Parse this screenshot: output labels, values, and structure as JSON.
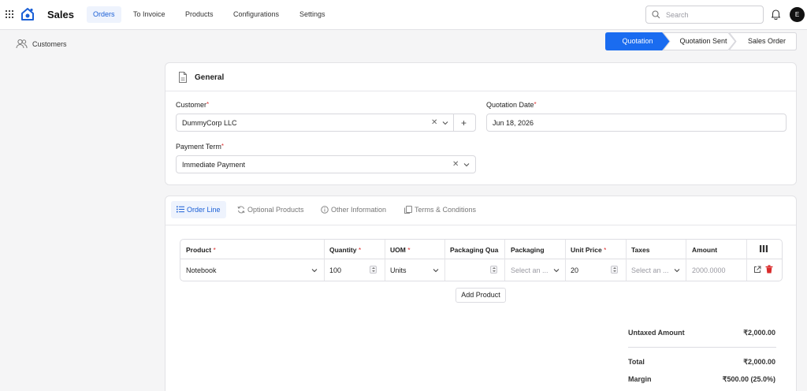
{
  "header": {
    "app_title": "Sales",
    "nav": [
      "Orders",
      "To Invoice",
      "Products",
      "Configurations",
      "Settings"
    ],
    "active_nav": "Orders",
    "search_placeholder": "Search",
    "avatar_initial": "E",
    "icons": [
      "apps-grid-icon",
      "app-logo-icon",
      "search-icon",
      "bell-icon"
    ]
  },
  "sidebar": {
    "items": [
      {
        "label": "Customers",
        "icon": "users-icon"
      }
    ]
  },
  "statusbar": {
    "steps": [
      "Quotation",
      "Quotation Sent",
      "Sales Order"
    ],
    "active": "Quotation",
    "active_color": "#1a6cf0"
  },
  "general": {
    "title": "General",
    "customer_label": "Customer",
    "customer_value": "DummyCorp LLC",
    "date_label": "Quotation Date",
    "date_value": "Jun 18, 2026",
    "term_label": "Payment Term",
    "term_value": "Immediate Payment"
  },
  "tabs": [
    "Order Line",
    "Optional Products",
    "Other Information",
    "Terms & Conditions"
  ],
  "order_lines": {
    "columns": [
      "Product",
      "Quantity",
      "UOM",
      "Packaging Qua",
      "Packaging",
      "Unit Price",
      "Taxes",
      "Amount"
    ],
    "rows": [
      {
        "product": "Notebook",
        "quantity": "100",
        "uom": "Units",
        "packaging_qty": "",
        "packaging": "Select an ...",
        "unit_price": "20",
        "taxes": "Select an ...",
        "amount": "2000.0000"
      }
    ],
    "add_product_label": "Add Product"
  },
  "totals": {
    "untaxed_label": "Untaxed Amount",
    "untaxed_value": "₹2,000.00",
    "total_label": "Total",
    "total_value": "₹2,000.00",
    "margin_label": "Margin",
    "margin_value": "₹500.00 (25.0%)"
  },
  "colors": {
    "accent": "#1a5fd6",
    "required": "#d33333",
    "delete": "#d92b2b"
  }
}
